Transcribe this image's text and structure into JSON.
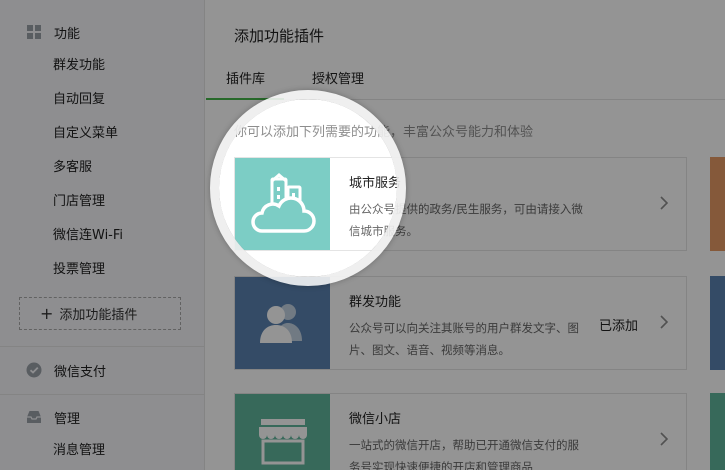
{
  "colors": {
    "accent_green": "#44b549",
    "city_teal": "#7ccdc5",
    "broadcast_blue": "#5b82b0",
    "shop_green": "#5fb59b",
    "edge_orange": "#e69a65"
  },
  "sidebar": {
    "section_function": {
      "label": "功能",
      "icon": "grid-icon"
    },
    "function_items": [
      {
        "label": "群发功能"
      },
      {
        "label": "自动回复"
      },
      {
        "label": "自定义菜单"
      },
      {
        "label": "多客服"
      },
      {
        "label": "门店管理"
      },
      {
        "label": "微信连Wi-Fi"
      },
      {
        "label": "投票管理"
      }
    ],
    "add_plugin": {
      "icon": "plus-icon",
      "label": "添加功能插件"
    },
    "section_pay": {
      "label": "微信支付",
      "icon": "wechat-pay-icon"
    },
    "section_manage": {
      "label": "管理",
      "icon": "inbox-icon"
    },
    "manage_items": [
      {
        "label": "消息管理"
      }
    ]
  },
  "main": {
    "title": "添加功能插件",
    "tabs": [
      {
        "label": "插件库",
        "active": true
      },
      {
        "label": "授权管理",
        "active": false
      }
    ],
    "intro": "你可以添加下列需要的功能，丰富公众号能力和体验",
    "plugins": [
      {
        "name": "城市服务",
        "desc": "由公众号提供的政务/民生服务，可由请接入微信城市服务。",
        "status": "",
        "icon": "city-cloud-icon"
      },
      {
        "name": "群发功能",
        "desc": "公众号可以向关注其账号的用户群发文字、图片、图文、语音、视频等消息。",
        "status": "已添加",
        "icon": "users-icon"
      },
      {
        "name": "微信小店",
        "desc": "一站式的微信开店，帮助已开通微信支付的服务号实现快速便捷的开店和管理商品",
        "status": "",
        "icon": "shop-icon"
      }
    ]
  }
}
